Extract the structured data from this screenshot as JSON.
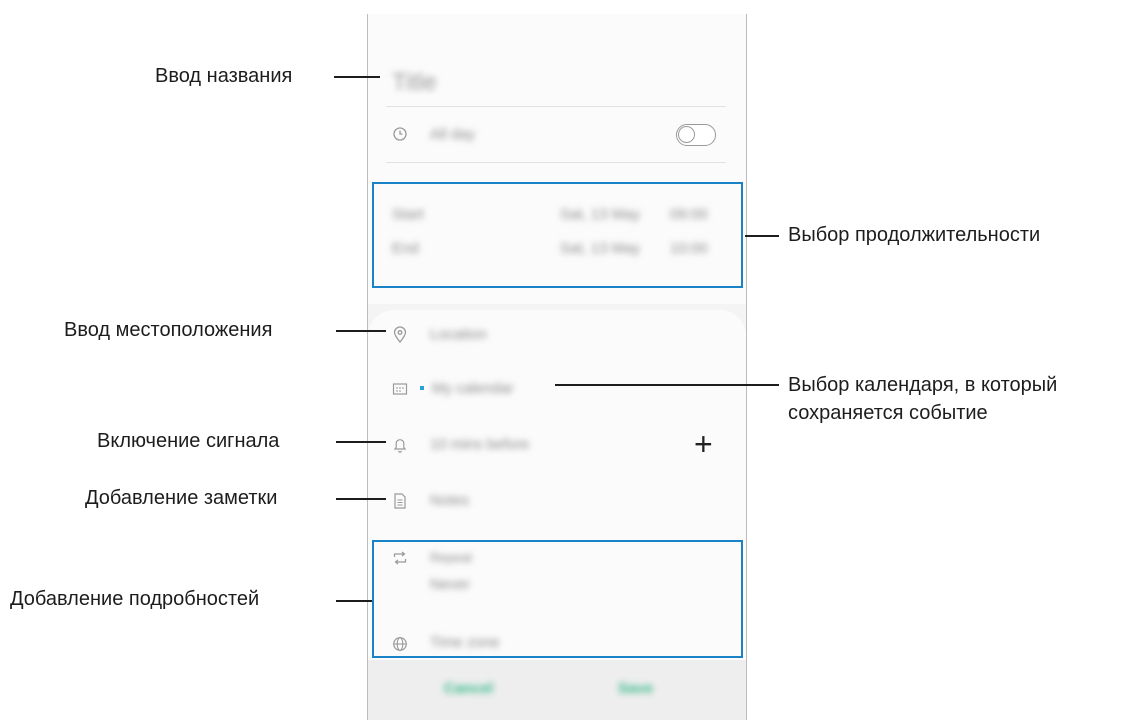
{
  "labels": {
    "title_input": "Ввод названия",
    "duration": "Выбор продолжительности",
    "location": "Ввод местоположения",
    "calendar_line1": "Выбор календаря, в который",
    "calendar_line2": "сохраняется событие",
    "alarm": "Включение сигнала",
    "note": "Добавление заметки",
    "details": "Добавление подробностей"
  },
  "form": {
    "title_placeholder": "Title",
    "all_day": "All day",
    "start_label": "Start",
    "end_label": "End",
    "start_date": "Sat, 13 May",
    "start_time": "09:00",
    "end_date": "Sat, 13 May",
    "end_time": "10:00",
    "location_placeholder": "Location",
    "calendar_name": "My calendar",
    "reminder": "10 mins before",
    "notes": "Notes",
    "repeat_label": "Repeat",
    "repeat_value": "Never",
    "timezone": "Time zone",
    "cancel": "Cancel",
    "save": "Save",
    "add_symbol": "+"
  },
  "colors": {
    "highlight": "#1a83c7",
    "accent_green": "#37b889",
    "calendar_dot": "#2d9fd9"
  },
  "icons": [
    "clock-icon",
    "location-pin-icon",
    "calendar-icon",
    "bell-icon",
    "note-icon",
    "repeat-icon",
    "globe-icon",
    "plus-icon"
  ]
}
